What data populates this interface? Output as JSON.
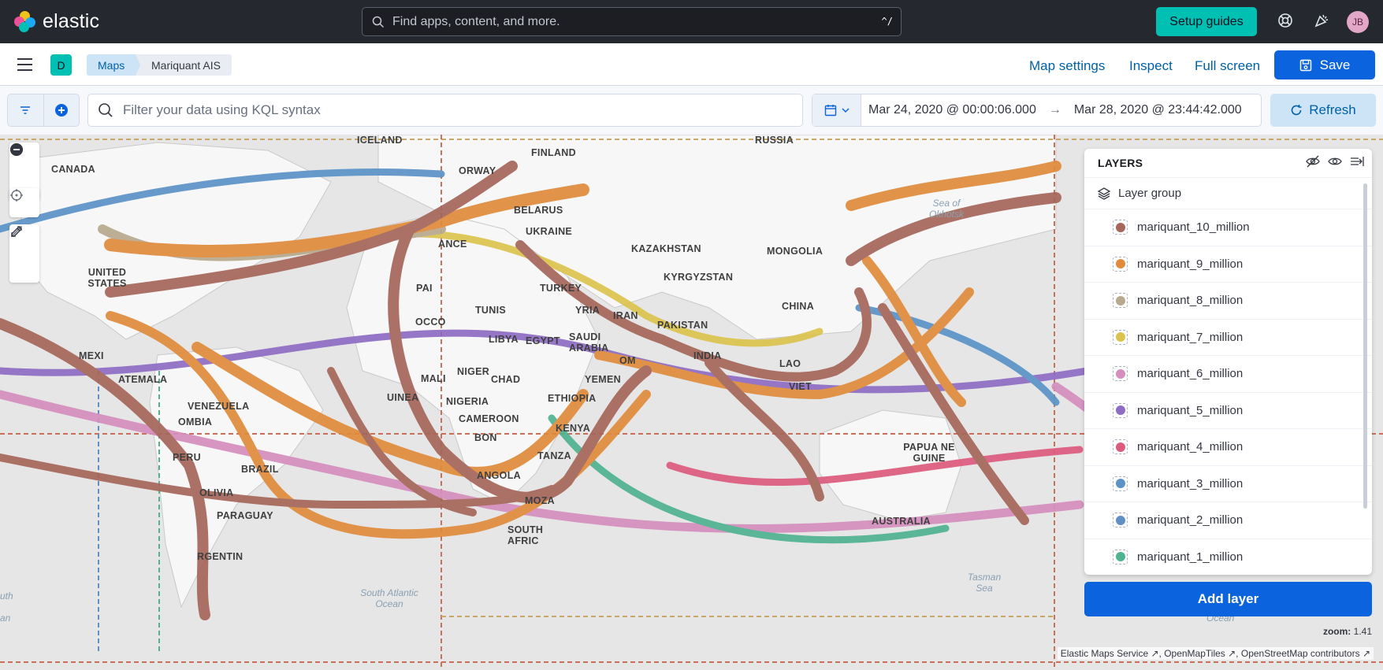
{
  "topbar": {
    "brand": "elastic",
    "search_placeholder": "Find apps, content, and more.",
    "search_shortcut": "^/",
    "setup_guides": "Setup guides",
    "avatar_initials": "JB"
  },
  "subbar": {
    "space_initial": "D",
    "breadcrumbs": [
      "Maps",
      "Mariquant AIS"
    ],
    "links": [
      "Map settings",
      "Inspect",
      "Full screen"
    ],
    "save": "Save"
  },
  "querybar": {
    "kql_placeholder": "Filter your data using KQL syntax",
    "date_start": "Mar 24, 2020 @ 00:00:06.000",
    "date_arrow": "→",
    "date_end": "Mar 28, 2020 @ 23:44:42.000",
    "refresh": "Refresh"
  },
  "map": {
    "labels": [
      "ICELAND",
      "FINLAND",
      "RUSSIA",
      "CANADA",
      "ORWAY",
      "BELARUS",
      "UKRAINE",
      "KAZAKHSTAN",
      "MONGOLIA",
      "KYRGYZSTAN",
      "UNITED STATES",
      "TURKEY",
      "CHINA",
      "TUNIS",
      "LIBYA",
      "EGYPT",
      "SAUDI ARABIA",
      "IRAN",
      "PAKISTAN",
      "INDIA",
      "MEXI",
      "ATEMALA",
      "VENEZUELA",
      "OMBIA",
      "NIGER",
      "CHAD",
      "NIGERIA",
      "ETHIOPIA",
      "CAMEROON",
      "KENYA",
      "PERU",
      "BRAZIL",
      "OLIVIA",
      "PARAGUAY",
      "RGENTIN",
      "TANZA",
      "ANGOLA",
      "MOZA",
      "SOUTH AFRIC",
      "AUSTRALIA",
      "PAPUA NE GUINE",
      "ANCE",
      "PAI",
      "OCCO",
      "MALI",
      "UINEA",
      "YEMEN",
      "OM",
      "YRIA",
      "LAO",
      "VIET",
      "BON"
    ],
    "oceans": [
      "Sea of Okhotsk",
      "South Atlantic Ocean",
      "Tasman Sea",
      "Ocean",
      "uth",
      "an"
    ],
    "zoom_label": "zoom:",
    "zoom_value": "1.41",
    "attribution": [
      "Elastic Maps Service",
      "OpenMapTiles",
      "OpenStreetMap contributors"
    ]
  },
  "layers": {
    "title": "LAYERS",
    "group": "Layer group",
    "items": [
      {
        "name": "mariquant_10_million",
        "color": "#a6665a"
      },
      {
        "name": "mariquant_9_million",
        "color": "#e08b3c"
      },
      {
        "name": "mariquant_8_million",
        "color": "#b8a98e"
      },
      {
        "name": "mariquant_7_million",
        "color": "#dcc34e"
      },
      {
        "name": "mariquant_6_million",
        "color": "#d58ebd"
      },
      {
        "name": "mariquant_5_million",
        "color": "#8e6cc4"
      },
      {
        "name": "mariquant_4_million",
        "color": "#dd5b7d"
      },
      {
        "name": "mariquant_3_million",
        "color": "#5b93c8"
      },
      {
        "name": "mariquant_2_million",
        "color": "#5f8fc5"
      },
      {
        "name": "mariquant_1_million",
        "color": "#4fb390"
      }
    ],
    "add_layer": "Add layer"
  }
}
